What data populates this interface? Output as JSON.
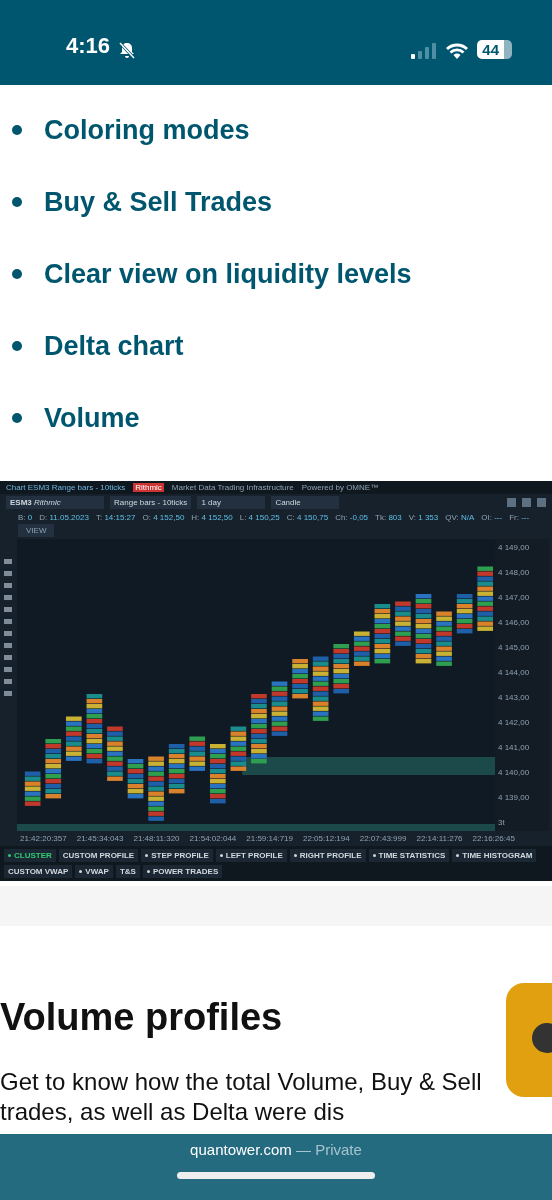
{
  "status_bar": {
    "time": "4:16",
    "battery": "44"
  },
  "features": [
    "Coloring modes",
    "Buy & Sell Trades",
    "Clear view on liquidity levels",
    "Delta chart",
    "Volume"
  ],
  "chart_window": {
    "title": "Chart ESM3 Range bars - 10ticks",
    "provider": "Rithmic",
    "provider_note": "Market Data Trading Infrastructure",
    "powered": "Powered by OMNE™",
    "symbol": "ESM3",
    "symbol_note": "Rithmic",
    "aggregation": "Range bars - 10ticks",
    "period": "1 day",
    "style": "Candle",
    "view_label": "VIEW",
    "info": [
      {
        "label": "B:",
        "value": "0"
      },
      {
        "label": "D:",
        "value": "11.05.2023"
      },
      {
        "label": "T:",
        "value": "14:15:27"
      },
      {
        "label": "O:",
        "value": "4 152,50"
      },
      {
        "label": "H:",
        "value": "4 152,50"
      },
      {
        "label": "L:",
        "value": "4 150,25"
      },
      {
        "label": "C:",
        "value": "4 150,75"
      },
      {
        "label": "Ch:",
        "value": "-0,05"
      },
      {
        "label": "Tk:",
        "value": "803"
      },
      {
        "label": "V:",
        "value": "1 353"
      },
      {
        "label": "QV:",
        "value": "N/A"
      },
      {
        "label": "OI:",
        "value": "---"
      },
      {
        "label": "Fr:",
        "value": "---"
      }
    ],
    "prices": [
      "4 149,00",
      "4 148,00",
      "4 147,00",
      "4 146,00",
      "4 145,00",
      "4 144,00",
      "4 143,00",
      "4 142,00",
      "4 141,00",
      "4 140,00",
      "4 139,00"
    ],
    "times": [
      "21:42:20:357",
      "21:45:34:043",
      "21:48:11:320",
      "21:54:02:044",
      "21:59:14:719",
      "22:05:12:194",
      "22:07:43:999",
      "22:14:11:276",
      "22:16:26:45"
    ],
    "zoom_label": "3t",
    "tabs": [
      {
        "label": "CLUSTER",
        "dot": true,
        "selected": true
      },
      {
        "label": "CUSTOM PROFILE",
        "dot": false,
        "selected": false
      },
      {
        "label": "STEP PROFILE",
        "dot": true,
        "selected": false
      },
      {
        "label": "LEFT PROFILE",
        "dot": true,
        "selected": false
      },
      {
        "label": "RIGHT PROFILE",
        "dot": true,
        "selected": false
      },
      {
        "label": "TIME STATISTICS",
        "dot": true,
        "selected": false
      },
      {
        "label": "TIME HISTOGRAM",
        "dot": true,
        "selected": false
      },
      {
        "label": "CUSTOM VWAP",
        "dot": false,
        "selected": false
      },
      {
        "label": "VWAP",
        "dot": true,
        "selected": false
      },
      {
        "label": "T&S",
        "dot": false,
        "selected": false
      },
      {
        "label": "POWER TRADES",
        "dot": true,
        "selected": false
      }
    ]
  },
  "section": {
    "heading": "Volume profiles",
    "paragraph": "Get to know how the total Volume, Buy & Sell trades, as well as Delta were dis"
  },
  "browser_bar": {
    "domain": "quantower.com",
    "mode": "— Private"
  }
}
